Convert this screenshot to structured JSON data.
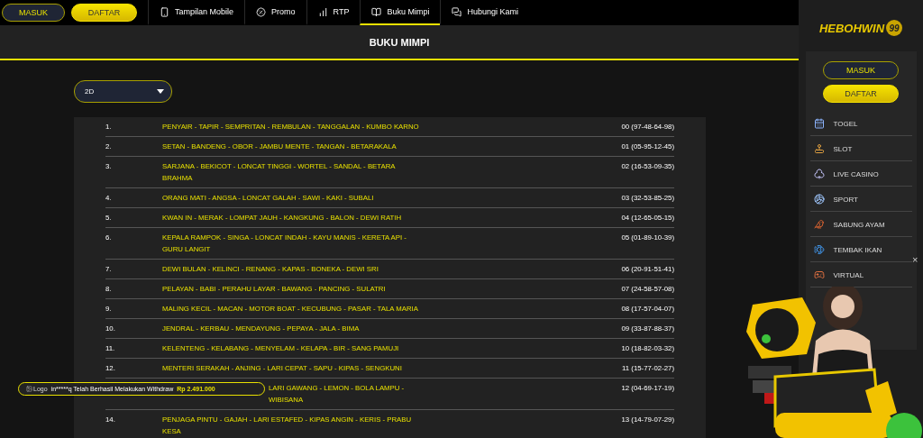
{
  "top_nav": {
    "buttons": [
      {
        "label": "MASUK",
        "kind": "outline"
      },
      {
        "label": "DAFTAR",
        "kind": "filled"
      }
    ],
    "items": [
      {
        "label": "Tampilan Mobile",
        "kind": "mobile",
        "selected": false
      },
      {
        "label": "Promo",
        "kind": "promo",
        "selected": false
      },
      {
        "label": "RTP",
        "kind": "rtp",
        "selected": false
      },
      {
        "label": "Buku Mimpi",
        "kind": "book",
        "selected": true
      },
      {
        "label": "Hubungi Kami",
        "kind": "chat",
        "selected": false
      }
    ]
  },
  "page_title": "BUKU MIMPI",
  "dropdown": {
    "value": "2D"
  },
  "rows": [
    {
      "number": "1.",
      "names": "PENYAIR - TAPIR - SEMPRITAN - REMBULAN - TANGGALAN - KUMBO KARNO",
      "code": "00 (97-48-64-98)"
    },
    {
      "number": "2.",
      "names": "SETAN - BANDENG - OBOR - JAMBU MENTE - TANGAN - BETARAKALA",
      "code": "01 (05-95-12-45)"
    },
    {
      "number": "3.",
      "names": "SARJANA - BEKICOT - LONCAT TINGGI - WORTEL - SANDAL - BETARA BRAHMA",
      "code": "02 (16-53-09-35)"
    },
    {
      "number": "4.",
      "names": "ORANG MATI - ANGSA - LONCAT GALAH - SAWI - KAKI - SUBALI",
      "code": "03 (32-53-85-25)"
    },
    {
      "number": "5.",
      "names": "KWAN IN - MERAK - LOMPAT JAUH - KANGKUNG - BALON - DEWI RATIH",
      "code": "04 (12-65-05-15)"
    },
    {
      "number": "6.",
      "names": "KEPALA RAMPOK - SINGA - LONCAT INDAH - KAYU MANIS - KERETA API - GURU LANGIT",
      "code": "05 (01-89-10-39)"
    },
    {
      "number": "7.",
      "names": "DEWI BULAN - KELINCI - RENANG - KAPAS - BONEKA - DEWI SRI",
      "code": "06 (20-91-51-41)"
    },
    {
      "number": "8.",
      "names": "PELAYAN - BABI - PERAHU LAYAR - BAWANG - PANCING - SULATRI",
      "code": "07 (24-58-57-08)"
    },
    {
      "number": "9.",
      "names": "MALING KECIL - MACAN - MOTOR BOAT - KECUBUNG - PASAR - TALA MARIA",
      "code": "08 (17-57-04-07)"
    },
    {
      "number": "10.",
      "names": "JENDRAL - KERBAU - MENDAYUNG - PEPAYA - JALA - BIMA",
      "code": "09 (33-87-88-37)"
    },
    {
      "number": "11.",
      "names": "KELENTENG - KELABANG - MENYELAM - KELAPA - BIR - SANG PAMUJI",
      "code": "10 (18-82-03-32)"
    },
    {
      "number": "12.",
      "names": "MENTERI SERAKAH - ANJING - LARI CEPAT - SAPU - KIPAS - SENGKUNI",
      "code": "11 (15-77-02-27)"
    },
    {
      "names": "LARI GAWANG - LEMON - BOLA LAMPU - WIBISANA",
      "code": "12 (04-69-17-19)"
    },
    {
      "number": "14.",
      "names": "PENJAGA PINTU - GAJAH - LARI ESTAFED - KIPAS ANGIN - KERIS - PRABU KESA",
      "code": "13 (14-79-07-29)"
    }
  ],
  "toast": {
    "image_alt": "Logo",
    "message": "in*****q Telah Berhasil Melakukan Withdraw",
    "amount": "Rp 2.491.000"
  },
  "sidebar": {
    "logo": {
      "text": "HEBOHWIN",
      "suffix": "99"
    },
    "buttons": [
      {
        "label": "MASUK",
        "kind": "outline"
      },
      {
        "label": "DAFTAR",
        "kind": "filled"
      }
    ],
    "items": [
      {
        "label": "TOGEL",
        "kind": "togel"
      },
      {
        "label": "SLOT",
        "kind": "slot"
      },
      {
        "label": "LIVE CASINO",
        "kind": "casino"
      },
      {
        "label": "SPORT",
        "kind": "sport"
      },
      {
        "label": "SABUNG AYAM",
        "kind": "cock"
      },
      {
        "label": "TEMBAK IKAN",
        "kind": "fish"
      },
      {
        "label": "VIRTUAL",
        "kind": "virtual"
      }
    ]
  },
  "promo": {
    "kind": "picture",
    "close": "×"
  }
}
